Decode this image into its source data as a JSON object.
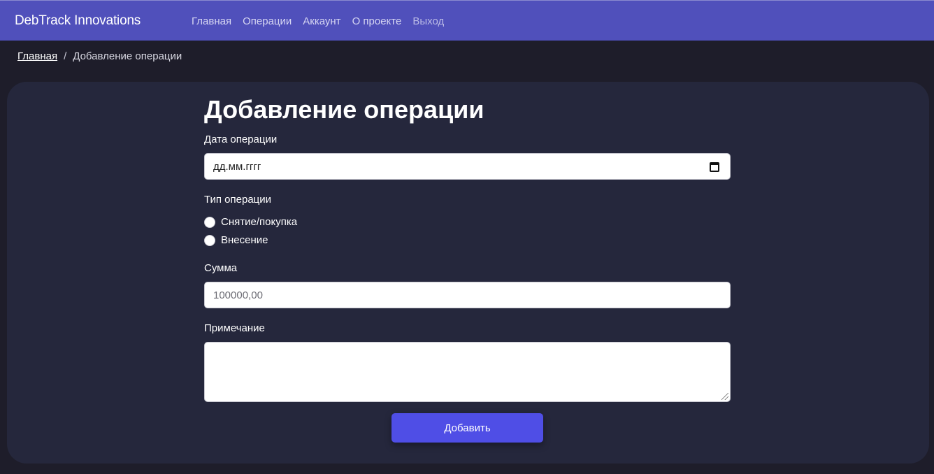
{
  "app": {
    "brand": "DebTrack Innovations"
  },
  "nav": {
    "items": [
      {
        "label": "Главная"
      },
      {
        "label": "Операции"
      },
      {
        "label": "Аккаунт"
      },
      {
        "label": "О проекте"
      },
      {
        "label": "Выход"
      }
    ]
  },
  "breadcrumb": {
    "home": "Главная",
    "separator": "/",
    "current": "Добавление операции"
  },
  "form": {
    "title": "Добавление операции",
    "date": {
      "label": "Дата операции",
      "value": "дд.мм.гггг",
      "icon": "calendar-icon"
    },
    "type": {
      "label": "Тип операции",
      "options": [
        {
          "label": "Снятие/покупка",
          "selected": false
        },
        {
          "label": "Внесение",
          "selected": false
        }
      ]
    },
    "amount": {
      "label": "Сумма",
      "placeholder": "100000,00"
    },
    "note": {
      "label": "Примечание",
      "value": ""
    },
    "submit_label": "Добавить"
  },
  "colors": {
    "navbar": "#5050bb",
    "page_bg": "#1e1d2a",
    "card_bg": "#25273c",
    "accent_button": "#4f4ee6"
  }
}
